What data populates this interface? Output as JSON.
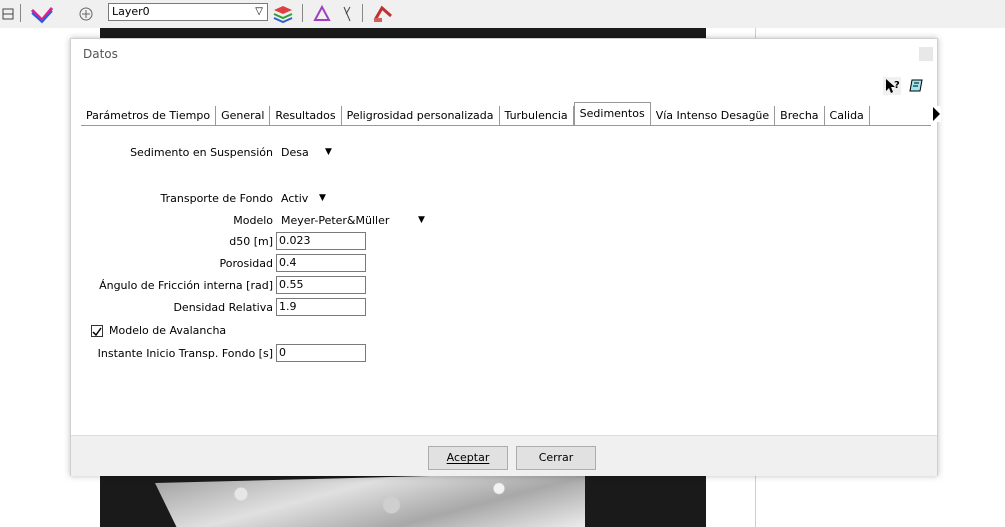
{
  "toolbar": {
    "layer_value": "Layer0"
  },
  "dialog": {
    "title": "Datos",
    "tabs": [
      {
        "label": "Parámetros de Tiempo"
      },
      {
        "label": "General"
      },
      {
        "label": "Resultados"
      },
      {
        "label": "Peligrosidad personalizada"
      },
      {
        "label": "Turbulencia"
      },
      {
        "label": "Sedimentos"
      },
      {
        "label": "Vía Intenso Desagüe"
      },
      {
        "label": "Brecha"
      },
      {
        "label": "Calida"
      }
    ],
    "active_tab": "Sedimentos",
    "form": {
      "suspension_label": "Sedimento en Suspensión",
      "suspension_value": "Desa",
      "bed_transport_label": "Transporte de Fondo",
      "bed_transport_value": "Activ",
      "model_label": "Modelo",
      "model_value": "Meyer-Peter&Müller",
      "d50_label": "d50 [m]",
      "d50_value": "0.023",
      "porosity_label": "Porosidad",
      "porosity_value": "0.4",
      "friction_label": "Ángulo de Fricción interna [rad]",
      "friction_value": "0.55",
      "density_label": "Densidad Relativa",
      "density_value": "1.9",
      "avalanche_label": "Modelo de Avalancha",
      "avalanche_checked": true,
      "start_label": "Instante Inicio Transp. Fondo [s]",
      "start_value": "0"
    },
    "buttons": {
      "accept_label": "Aceptar",
      "close_label": "Cerrar"
    }
  }
}
